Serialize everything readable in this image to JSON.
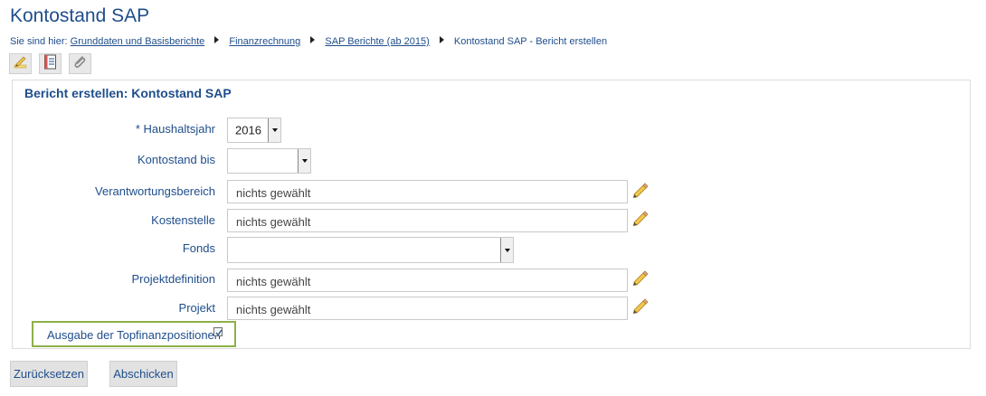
{
  "page_title": "Kontostand SAP",
  "breadcrumb": {
    "prefix": "Sie sind hier:",
    "items": [
      "Grunddaten und Basisberichte",
      "Finanzrechnung",
      "SAP Berichte (ab 2015)"
    ],
    "current": "Kontostand SAP - Bericht erstellen"
  },
  "toolbar": {
    "icons": [
      "edit-pencil-icon",
      "document-icon",
      "paperclip-icon"
    ]
  },
  "form": {
    "title": "Bericht erstellen: Kontostand SAP",
    "haushaltsjahr": {
      "label": "* Haushaltsjahr",
      "value": "2016"
    },
    "kontostand_bis": {
      "label": "Kontostand bis",
      "value": ""
    },
    "verantwortungsbereich": {
      "label": "Verantwortungsbereich",
      "value": "nichts gewählt"
    },
    "kostenstelle": {
      "label": "Kostenstelle",
      "value": "nichts gewählt"
    },
    "fonds": {
      "label": "Fonds",
      "value": ""
    },
    "projektdefinition": {
      "label": "Projektdefinition",
      "value": "nichts gewählt"
    },
    "projekt": {
      "label": "Projekt",
      "value": "nichts gewählt"
    },
    "topfinanz": {
      "label": "Ausgabe der Topfinanzpositionen",
      "checked": true
    }
  },
  "buttons": {
    "reset": "Zurücksetzen",
    "submit": "Abschicken"
  },
  "colors": {
    "text_blue": "#1f4e8c",
    "highlight_green": "#8db04a",
    "pencil_yellow": "#f3c64e"
  }
}
